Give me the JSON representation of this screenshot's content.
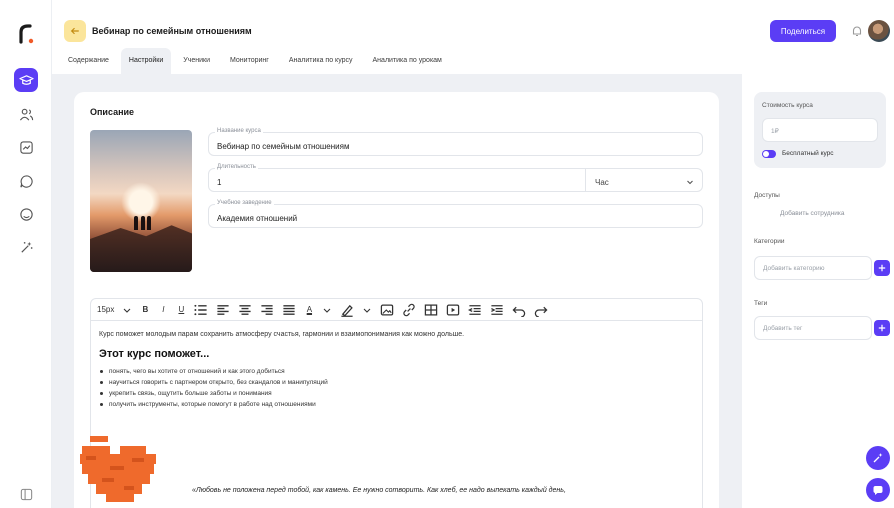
{
  "header": {
    "title": "Вебинар по семейным отношениям",
    "share_label": "Поделиться"
  },
  "tabs": [
    {
      "label": "Содержание",
      "active": false
    },
    {
      "label": "Настройки",
      "active": true
    },
    {
      "label": "Ученики",
      "active": false
    },
    {
      "label": "Мониторинг",
      "active": false
    },
    {
      "label": "Аналитика по курсу",
      "active": false
    },
    {
      "label": "Аналитика по урокам",
      "active": false
    }
  ],
  "description": {
    "section_title": "Описание",
    "course_name_label": "Название курса",
    "course_name": "Вебинар по семейным отношениям",
    "duration_label": "Длительность",
    "duration_value": "1",
    "duration_unit": "Час",
    "school_label": "Учебное заведение",
    "school_value": "Академия отношений"
  },
  "editor": {
    "toolbar": {
      "font_size": "15px"
    },
    "paragraph": "Курс поможет молодым парам сохранить атмосферу счастья, гармонии и взаимопонимания как можно дольше.",
    "heading": "Этот курс поможет...",
    "bullets": [
      "понять, чего вы хотите от отношений и как этого добиться",
      "научиться говорить с партнером открыто, без скандалов и манипуляций",
      "укрепить связь, ощутить больше заботы и понимания",
      "получить инструменты, которые помогут в работе над отношениями"
    ],
    "quote": "«Любовь не положена перед тобой, как камень. Ее нужно сотворить. Как хлеб, ее надо выпекать каждый день,"
  },
  "right_panel": {
    "price_label": "Стоимость курса",
    "price_placeholder": "1₽",
    "free_label": "Бесплатный курс",
    "access_label": "Доступы",
    "add_employee": "Добавить сотрудника",
    "categories_label": "Категории",
    "add_category_placeholder": "Добавить категорию",
    "tags_label": "Теги",
    "add_tag_placeholder": "Добавить тег"
  },
  "colors": {
    "accent": "#5b3df5",
    "back_button": "#fbe59b",
    "background": "#eef0f4"
  }
}
